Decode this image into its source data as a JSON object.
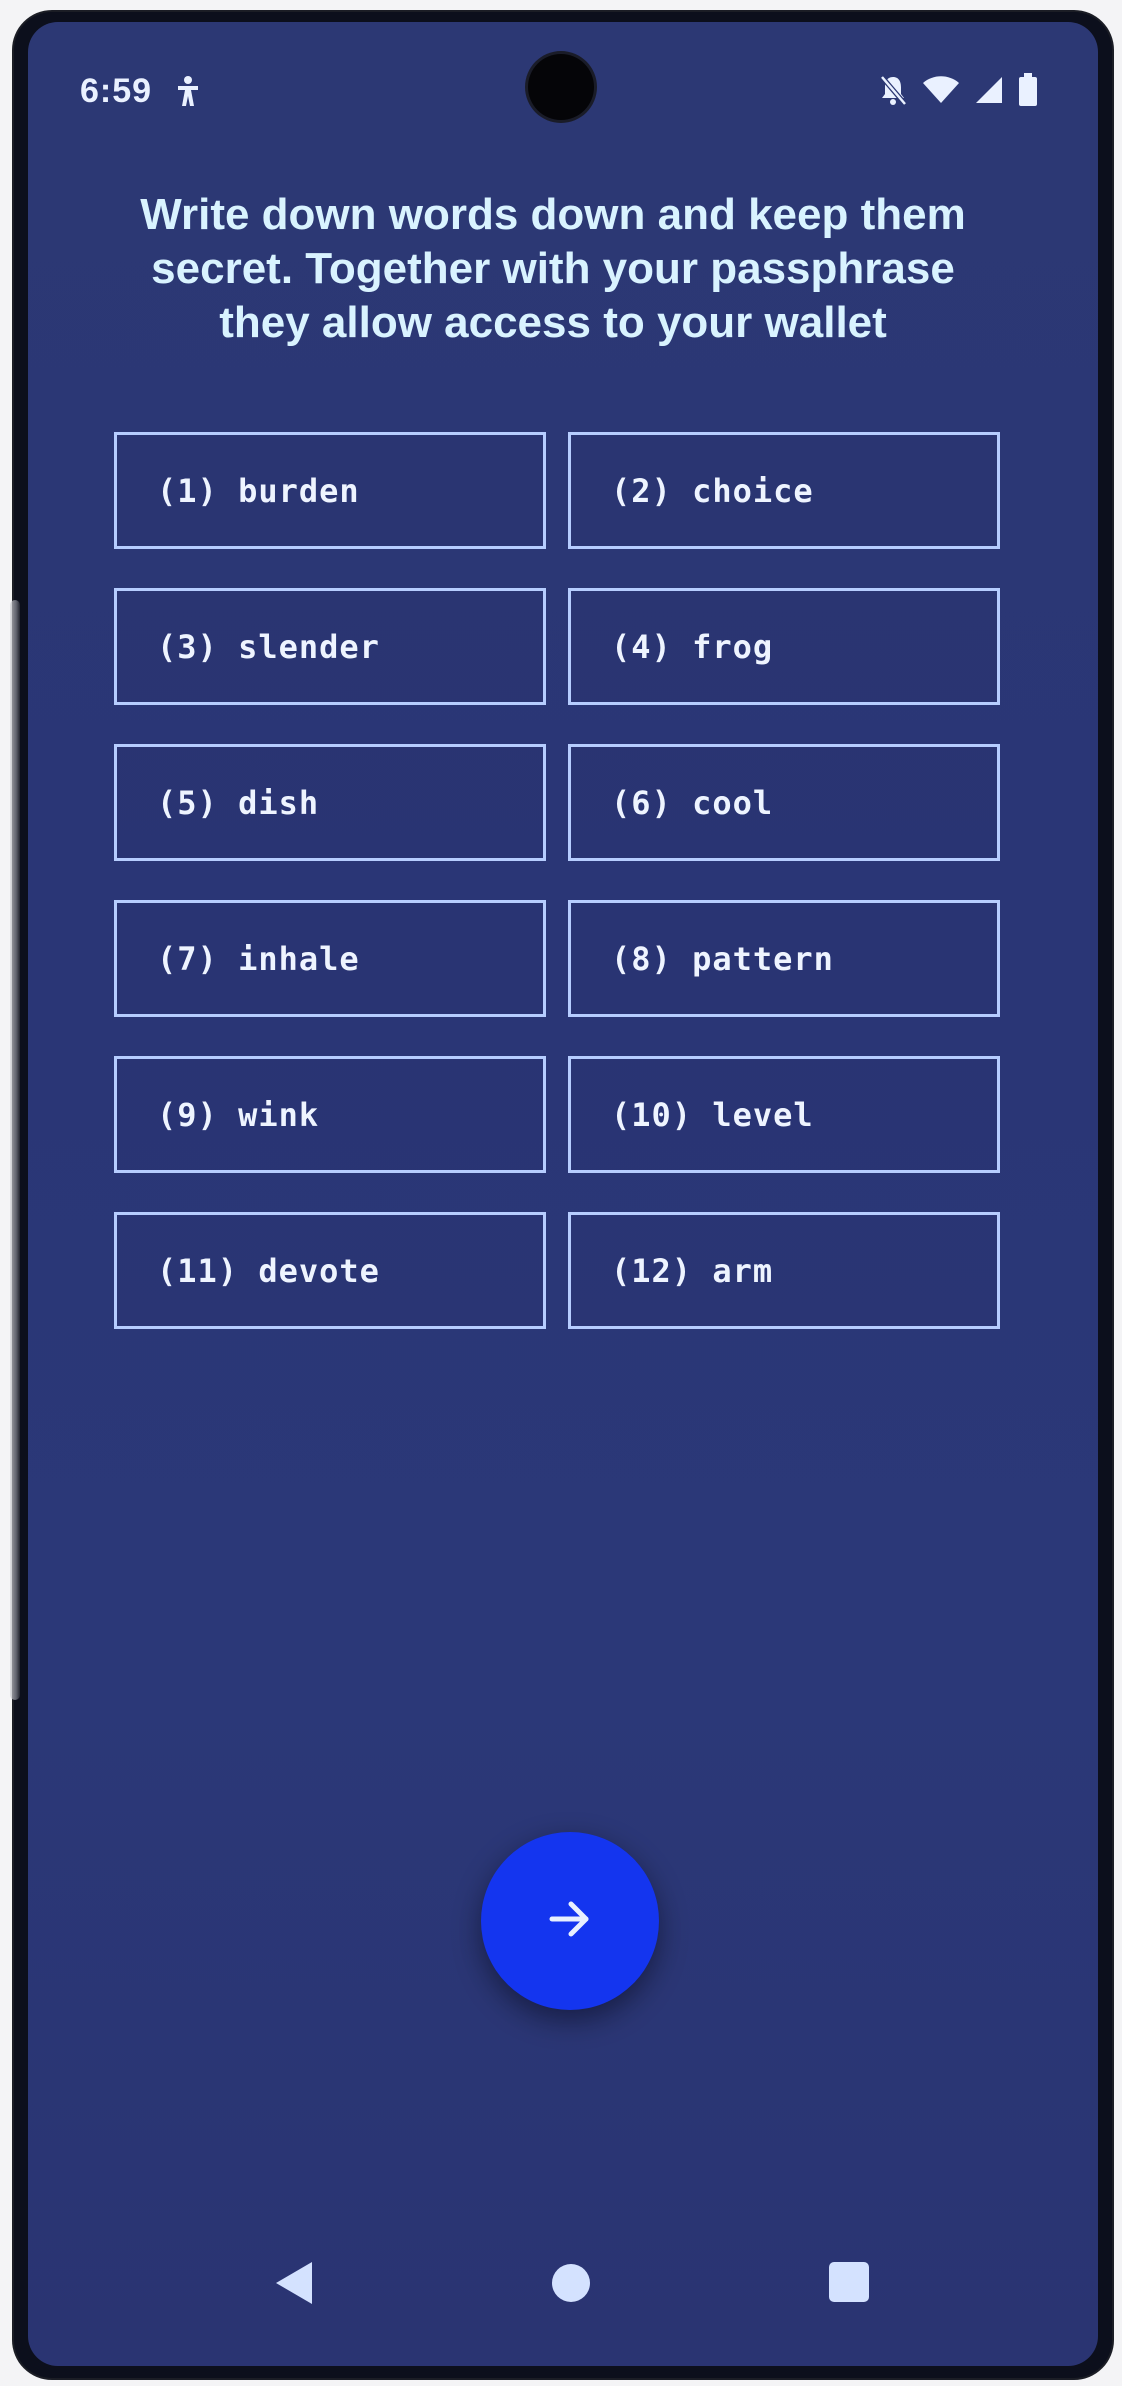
{
  "status_bar": {
    "time": "6:59",
    "notification_icon": "accessibility-icon",
    "icons": [
      "silent-bell-icon",
      "wifi-icon",
      "signal-icon",
      "battery-icon"
    ]
  },
  "heading": "Write down words down and keep them secret. Together with your passphrase they allow access to your wallet",
  "words": [
    "(1) burden",
    "(2) choice",
    "(3) slender",
    "(4) frog",
    "(5) dish",
    "(6) cool",
    "(7) inhale",
    "(8) pattern",
    "(9) wink",
    "(10) level",
    "(11) devote",
    "(12) arm"
  ],
  "fab": {
    "icon": "arrow-right-icon"
  },
  "nav_bar": {
    "icons": [
      "back-triangle-icon",
      "home-circle-icon",
      "recents-square-icon"
    ]
  },
  "colors": {
    "background": "#2a3676",
    "text": "#d9f3ff",
    "box_border": "#b6cdff",
    "fab": "#1435ef"
  }
}
